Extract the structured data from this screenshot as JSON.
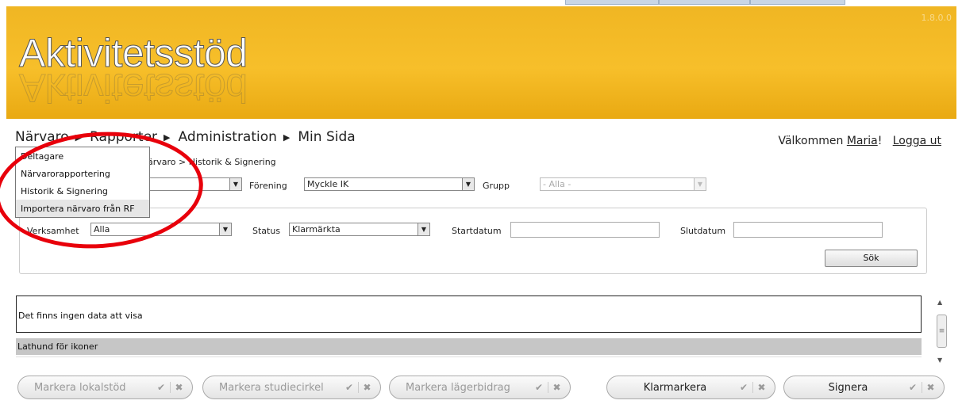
{
  "app": {
    "title": "Aktivitetsstöd",
    "version": "1.8.0.0"
  },
  "nav": {
    "items": [
      {
        "label": "Närvaro",
        "arrow": "▶"
      },
      {
        "label": "Rapporter",
        "arrow": "▶"
      },
      {
        "label": "Administration",
        "arrow": "▶"
      },
      {
        "label": "Min Sida",
        "arrow": ""
      }
    ]
  },
  "welcome": {
    "prefix": "Välkommen ",
    "user": "Maria",
    "suffix": "!",
    "logout": "Logga ut"
  },
  "breadcrumb": "ärvaro > Historik & Signering",
  "dropdown": {
    "items": [
      "Deltagare",
      "Närvarorapportering",
      "Historik & Signering",
      "Importera närvaro från RF"
    ]
  },
  "filters": {
    "forening_label": "Förening",
    "forening_value": "Myckle IK",
    "grupp_label": "Grupp",
    "grupp_value": "- Alla -",
    "verksamhet_label": "Verksamhet",
    "verksamhet_value": "Alla",
    "status_label": "Status",
    "status_value": "Klarmärkta",
    "startdatum_label": "Startdatum",
    "slutdatum_label": "Slutdatum",
    "search_button": "Sök"
  },
  "table": {
    "empty_message": "Det finns ingen data att visa",
    "legend_title": "Lathund för ikoner"
  },
  "actions": {
    "lokalstod": "Markera lokalstöd",
    "studiecirkel": "Markera studiecirkel",
    "lagerbidrag": "Markera lägerbidrag",
    "klarmarkera": "Klarmarkera",
    "signera": "Signera",
    "check_icon": "✔",
    "x_icon": "✖"
  },
  "colors": {
    "header": "#f4b820",
    "highlight_circle": "#e8000b"
  }
}
